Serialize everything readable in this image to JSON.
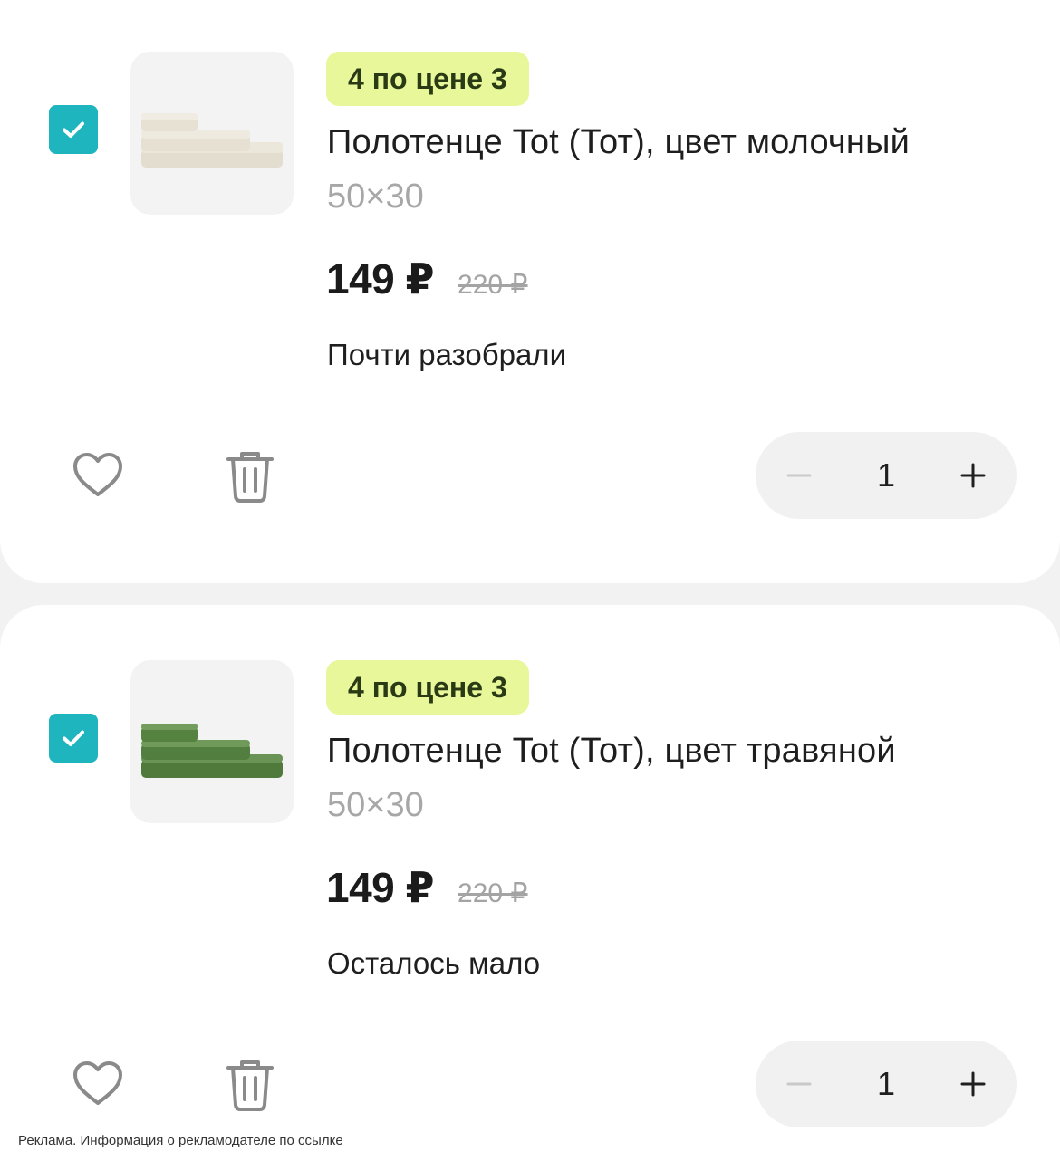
{
  "colors": {
    "accent": "#1fb5bf",
    "promo_bg": "#e7f79a",
    "icon_gray": "#8a8a8a"
  },
  "items": [
    {
      "selected": true,
      "promo": "4 по цене 3",
      "title": "Полотенце Tot (Тот), цвет молочный",
      "size": "50×30",
      "price": "149 ₽",
      "old_price": "220 ₽",
      "stock": "Почти разобрали",
      "quantity": "1",
      "image_color": "milk"
    },
    {
      "selected": true,
      "promo": "4 по цене 3",
      "title": "Полотенце Tot (Тот), цвет травяной",
      "size": "50×30",
      "price": "149 ₽",
      "old_price": "220 ₽",
      "stock": "Осталось мало",
      "quantity": "1",
      "image_color": "grass"
    }
  ],
  "icons": {
    "checkbox": "checkmark-icon",
    "favorite": "heart-icon",
    "delete": "trash-icon",
    "decrement": "minus-icon",
    "increment": "plus-icon"
  },
  "footer": {
    "ad_note": "Реклама. Информация о рекламодателе по ссылке"
  }
}
